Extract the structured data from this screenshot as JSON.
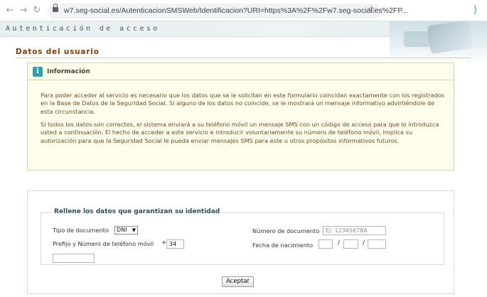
{
  "browser": {
    "back_icon": "arrow-left-icon",
    "forward_icon": "arrow-right-icon",
    "reload_icon": "reload-icon",
    "url": "w7.seg-social.es/AutenticacionSMSWeb/Identificacion?URI=https%3A%2F%2Fw7.seg-social.es%2FP...",
    "lock_icon": "lock-icon",
    "star_icon": "star-icon"
  },
  "header": {
    "title": "Autenticación de acceso"
  },
  "page": {
    "title": "Datos del usuario"
  },
  "info": {
    "icon": "info-icon",
    "icon_glyph": "i",
    "title": "Información",
    "paragraph1": "Para poder acceder al servicio es necesario que los datos que se le solicitan en este formulario coincidan exactamente con los registrados en la Base de Datos de la Seguridad Social. Si alguno de los datos no coincide, se le mostrará un mensaje informativo advirtiéndole de esta circunstancia.",
    "paragraph2": "Si todos los datos son correctos, el sistema enviará a su teléfono móvil un mensaje SMS con un código de acceso para que lo introduzca usted a continuación. El hecho de acceder a este servicio e introducir voluntariamente su número de teléfono móvil, implica su autorización para que la Seguridad Social le pueda enviar mensajes SMS para este u otros propósitos informativos futuros."
  },
  "form": {
    "legend": "Rellene los datos que garantizan su identidad",
    "doc_type_label": "Tipo de documento",
    "doc_type_value": "DNI",
    "doc_number_label": "Número de documento",
    "doc_number_placeholder": "Ej: 12345678A",
    "phone_label": "Prefijo y Número de teléfono móvil",
    "phone_plus": "+",
    "phone_prefix_value": "34",
    "phone_number_value": "",
    "birth_label": "Fecha de nacimiento",
    "date_separator": "/",
    "submit_label": "Aceptar"
  }
}
